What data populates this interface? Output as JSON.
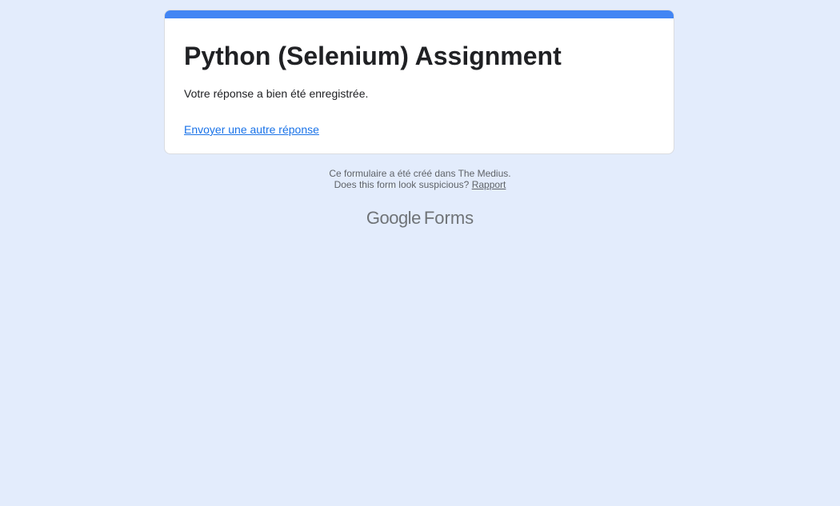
{
  "form": {
    "title": "Python (Selenium) Assignment",
    "confirmation_message": "Votre réponse a bien été enregistrée.",
    "another_response_link": "Envoyer une autre réponse",
    "accent_color": "#4285f4"
  },
  "footer": {
    "created_by_text": "Ce formulaire a été créé dans The Medius.",
    "suspicious_text": "Does this form look suspicious?",
    "report_link": "Rapport"
  },
  "branding": {
    "logo_word": "Google",
    "product_word": "Forms"
  },
  "colors": {
    "page_background": "#e3ecfc",
    "card_background": "#ffffff",
    "link_color": "#1a73e8",
    "text_color": "#202124",
    "muted_text": "#5f6368"
  }
}
